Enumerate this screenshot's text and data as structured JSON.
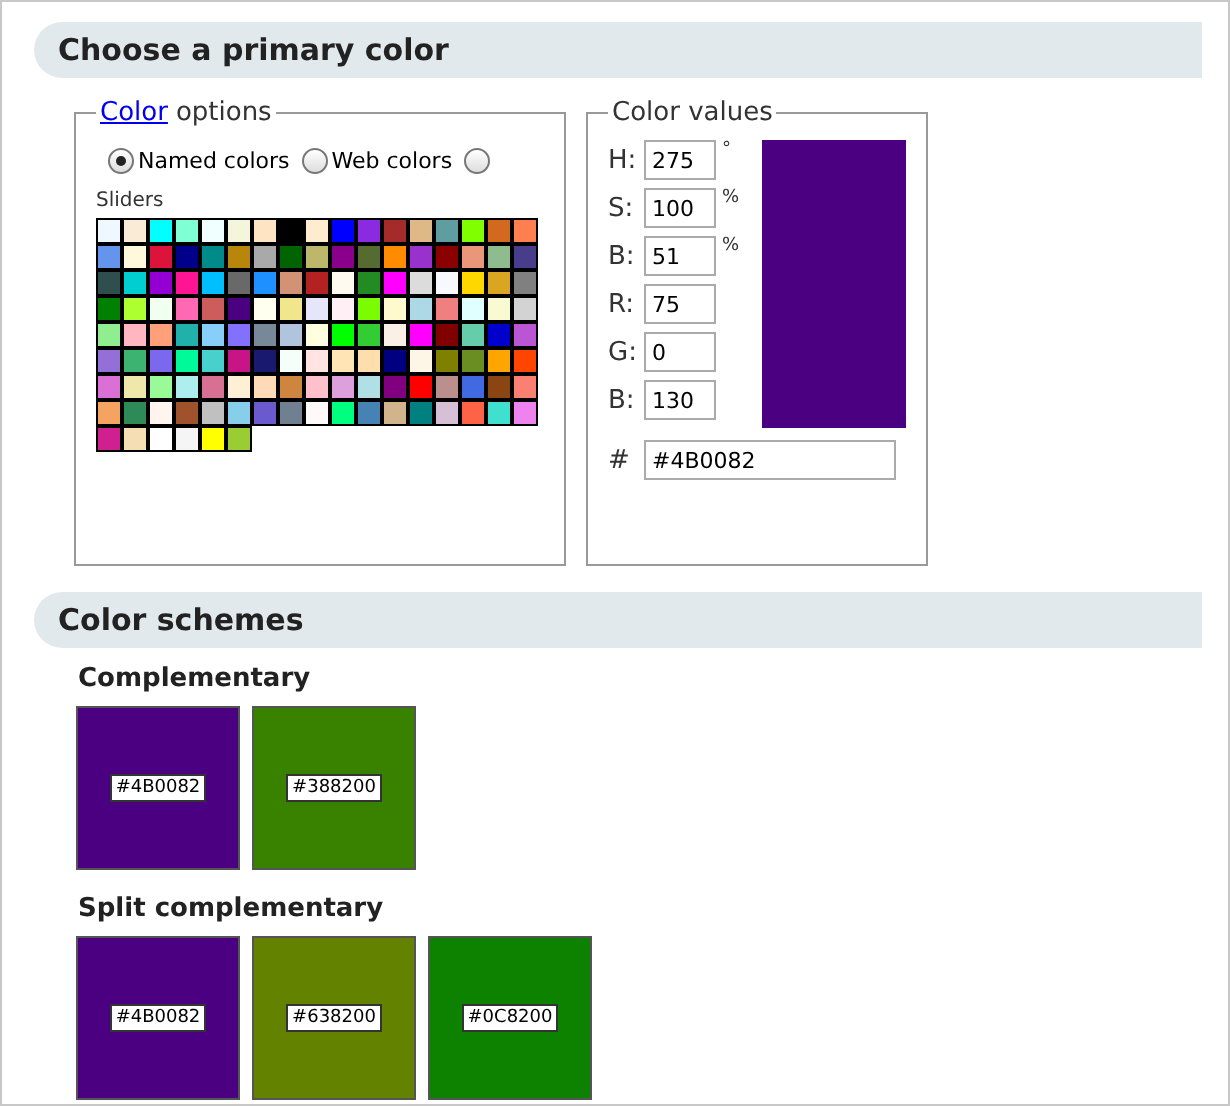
{
  "primary": {
    "title": "Choose a primary color",
    "options": {
      "legend_link": "Color",
      "legend_text": "options",
      "radios": [
        {
          "label": "Named colors",
          "selected": true
        },
        {
          "label": "Web colors",
          "selected": false
        },
        {
          "selected": false
        }
      ],
      "sliders_label": "Sliders",
      "swatches": [
        {
          "color": "#f0f8ff"
        },
        {
          "color": "#faebd7"
        },
        {
          "color": "#00ffff"
        },
        {
          "color": "#7fffd4"
        },
        {
          "color": "#f0ffff"
        },
        {
          "color": "#f5f5dc"
        },
        {
          "color": "#ffe4c4"
        },
        {
          "color": "#000000"
        },
        {
          "color": "#ffebcd"
        },
        {
          "color": "#0000ff"
        },
        {
          "color": "#8a2be2"
        },
        {
          "color": "#a52a2a"
        },
        {
          "color": "#deb887"
        },
        {
          "color": "#5f9ea0"
        },
        {
          "color": "#7fff00"
        },
        {
          "color": "#d2691e"
        },
        {
          "color": "#ff7f50"
        },
        {
          "color": "#6495ed"
        },
        {
          "color": "#fff8dc"
        },
        {
          "color": "#dc143c"
        },
        {
          "color": "#00008b"
        },
        {
          "color": "#008b8b"
        },
        {
          "color": "#b8860b"
        },
        {
          "color": "#a9a9a9"
        },
        {
          "color": "#006400"
        },
        {
          "color": "#bdb76b"
        },
        {
          "color": "#8b008b"
        },
        {
          "color": "#556b2f"
        },
        {
          "color": "#ff8c00"
        },
        {
          "color": "#9932cc"
        },
        {
          "color": "#8b0000"
        },
        {
          "color": "#e9967a"
        },
        {
          "color": "#8fbc8f"
        },
        {
          "color": "#483d8b"
        },
        {
          "color": "#2f4f4f"
        },
        {
          "color": "#00ced1"
        },
        {
          "color": "#9400d3"
        },
        {
          "color": "#ff1493"
        },
        {
          "color": "#00bfff"
        },
        {
          "color": "#696969"
        },
        {
          "color": "#1e90ff"
        },
        {
          "color": "#d19275"
        },
        {
          "color": "#b22222"
        },
        {
          "color": "#fffaf0"
        },
        {
          "color": "#228b22"
        },
        {
          "color": "#ff00ff"
        },
        {
          "color": "#dcdcdc"
        },
        {
          "color": "#f8f8ff"
        },
        {
          "color": "#ffd700"
        },
        {
          "color": "#daa520"
        },
        {
          "color": "#808080"
        },
        {
          "color": "#008000"
        },
        {
          "color": "#adff2f"
        },
        {
          "color": "#f0fff0"
        },
        {
          "color": "#ff69b4"
        },
        {
          "color": "#cd5c5c"
        },
        {
          "color": "#4b0082"
        },
        {
          "color": "#fffff0"
        },
        {
          "color": "#f0e68c"
        },
        {
          "color": "#e6e6fa"
        },
        {
          "color": "#fff0f5"
        },
        {
          "color": "#7cfc00"
        },
        {
          "color": "#fffacd"
        },
        {
          "color": "#add8e6"
        },
        {
          "color": "#f08080"
        },
        {
          "color": "#e0ffff"
        },
        {
          "color": "#fafad2"
        },
        {
          "color": "#d3d3d3"
        },
        {
          "color": "#90ee90"
        },
        {
          "color": "#ffb6c1"
        },
        {
          "color": "#ffa07a"
        },
        {
          "color": "#20b2aa"
        },
        {
          "color": "#87cefa"
        },
        {
          "color": "#8470ff"
        },
        {
          "color": "#778899"
        },
        {
          "color": "#b0c4de"
        },
        {
          "color": "#ffffe0"
        },
        {
          "color": "#00ff00"
        },
        {
          "color": "#32cd32"
        },
        {
          "color": "#faf0e6"
        },
        {
          "color": "#ff00ff"
        },
        {
          "color": "#800000"
        },
        {
          "color": "#66cdaa"
        },
        {
          "color": "#0000cd"
        },
        {
          "color": "#ba55d3"
        },
        {
          "color": "#9370d8"
        },
        {
          "color": "#3cb371"
        },
        {
          "color": "#7b68ee"
        },
        {
          "color": "#00fa9a"
        },
        {
          "color": "#48d1cc"
        },
        {
          "color": "#c71585"
        },
        {
          "color": "#191970"
        },
        {
          "color": "#f5fffa"
        },
        {
          "color": "#ffe4e1"
        },
        {
          "color": "#ffe4b5"
        },
        {
          "color": "#ffdead"
        },
        {
          "color": "#000080"
        },
        {
          "color": "#fdf5e6"
        },
        {
          "color": "#808000"
        },
        {
          "color": "#6b8e23"
        },
        {
          "color": "#ffa500"
        },
        {
          "color": "#ff4500"
        },
        {
          "color": "#da70d6"
        },
        {
          "color": "#eee8aa"
        },
        {
          "color": "#98fb98"
        },
        {
          "color": "#afeeee"
        },
        {
          "color": "#d87093"
        },
        {
          "color": "#ffefd5"
        },
        {
          "color": "#ffdab9"
        },
        {
          "color": "#cd853f"
        },
        {
          "color": "#ffc0cb"
        },
        {
          "color": "#dda0dd"
        },
        {
          "color": "#b0e0e6"
        },
        {
          "color": "#800080"
        },
        {
          "color": "#ff0000"
        },
        {
          "color": "#bc8f8f"
        },
        {
          "color": "#4169e1"
        },
        {
          "color": "#8b4513"
        },
        {
          "color": "#fa8072"
        },
        {
          "color": "#f4a460"
        },
        {
          "color": "#2e8b57"
        },
        {
          "color": "#fff5ee"
        },
        {
          "color": "#a0522d"
        },
        {
          "color": "#c0c0c0"
        },
        {
          "color": "#87ceeb"
        },
        {
          "color": "#6a5acd"
        },
        {
          "color": "#708090"
        },
        {
          "color": "#fffafa"
        },
        {
          "color": "#00ff7f"
        },
        {
          "color": "#4682b4"
        },
        {
          "color": "#d2b48c"
        },
        {
          "color": "#008080"
        },
        {
          "color": "#d8bfd8"
        },
        {
          "color": "#ff6347"
        },
        {
          "color": "#40e0d0"
        },
        {
          "color": "#ee82ee"
        },
        {
          "color": "#d02090"
        },
        {
          "color": "#f5deb3"
        },
        {
          "color": "#ffffff"
        },
        {
          "color": "#f5f5f5"
        },
        {
          "color": "#ffff00"
        },
        {
          "color": "#9acd32"
        }
      ]
    },
    "values": {
      "legend": "Color values",
      "fields": [
        {
          "label": "H:",
          "value": "275",
          "unit": "°"
        },
        {
          "label": "S:",
          "value": "100",
          "unit": "%"
        },
        {
          "label": "B:",
          "value": "51",
          "unit": "%"
        },
        {
          "label": "R:",
          "value": "75"
        },
        {
          "label": "G:",
          "value": "0"
        },
        {
          "label": "B:",
          "value": "130"
        }
      ],
      "preview": {
        "color": "#4b0082"
      },
      "hex_label": "#",
      "hex_value": "#4B0082"
    }
  },
  "schemes": {
    "title": "Color schemes",
    "groups": [
      {
        "title": "Complementary",
        "swatches": [
          {
            "color": "#4b0082",
            "label": "#4B0082"
          },
          {
            "color": "#388200",
            "label": "#388200"
          }
        ]
      },
      {
        "title": "Split complementary",
        "swatches": [
          {
            "color": "#4b0082",
            "label": "#4B0082"
          },
          {
            "color": "#638200",
            "label": "#638200"
          },
          {
            "color": "#0c8200",
            "label": "#0C8200"
          }
        ]
      }
    ]
  }
}
